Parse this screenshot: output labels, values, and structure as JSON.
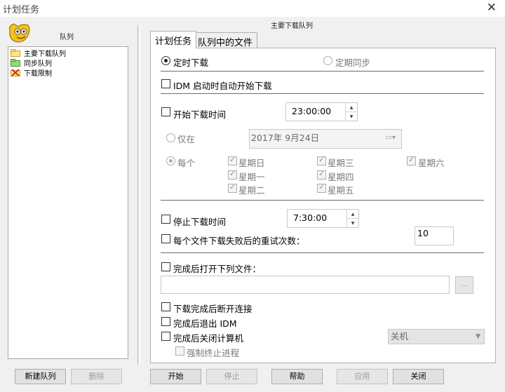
{
  "window": {
    "title": "计划任务"
  },
  "sidebar": {
    "header": "队列",
    "items": [
      {
        "label": "主要下载队列",
        "icon": "folder-icon"
      },
      {
        "label": "同步队列",
        "icon": "sync-folder-icon"
      },
      {
        "label": "下载限制",
        "icon": "limit-icon"
      }
    ],
    "new_queue_button": "新建队列",
    "delete_button": "删除"
  },
  "main": {
    "title": "主要下载队列",
    "tabs": [
      {
        "label": "计划任务"
      },
      {
        "label": "队列中的文件"
      }
    ],
    "schedule": {
      "mode_timed": "定时下载",
      "mode_sync": "定期同步",
      "auto_start_on_idm": "IDM 启动时自动开始下载",
      "start_time_label": "开始下载时间",
      "start_time_value": "23:00:00",
      "once_label": "仅在",
      "once_date": "2017年  9月24日",
      "every_label": "每个",
      "days": {
        "sun": "星期日",
        "mon": "星期一",
        "tue": "星期二",
        "wed": "星期三",
        "thu": "星期四",
        "fri": "星期五",
        "sat": "星期六"
      },
      "stop_time_label": "停止下载时间",
      "stop_time_value": "7:30:00",
      "retry_label": "每个文件下载失败后的重试次数：",
      "retry_value": "10",
      "open_file_label": "完成后打开下列文件：",
      "open_file_value": "",
      "browse_label": "...",
      "hangup_label": "下载完成后断开连接",
      "exit_idm_label": "完成后退出 IDM",
      "shutdown_label": "完成后关闭计算机",
      "shutdown_option": "关机",
      "force_kill_label": "强制终止进程"
    }
  },
  "footer": {
    "start": "开始",
    "stop": "停止",
    "help": "帮助",
    "apply": "应用",
    "close": "关闭"
  }
}
